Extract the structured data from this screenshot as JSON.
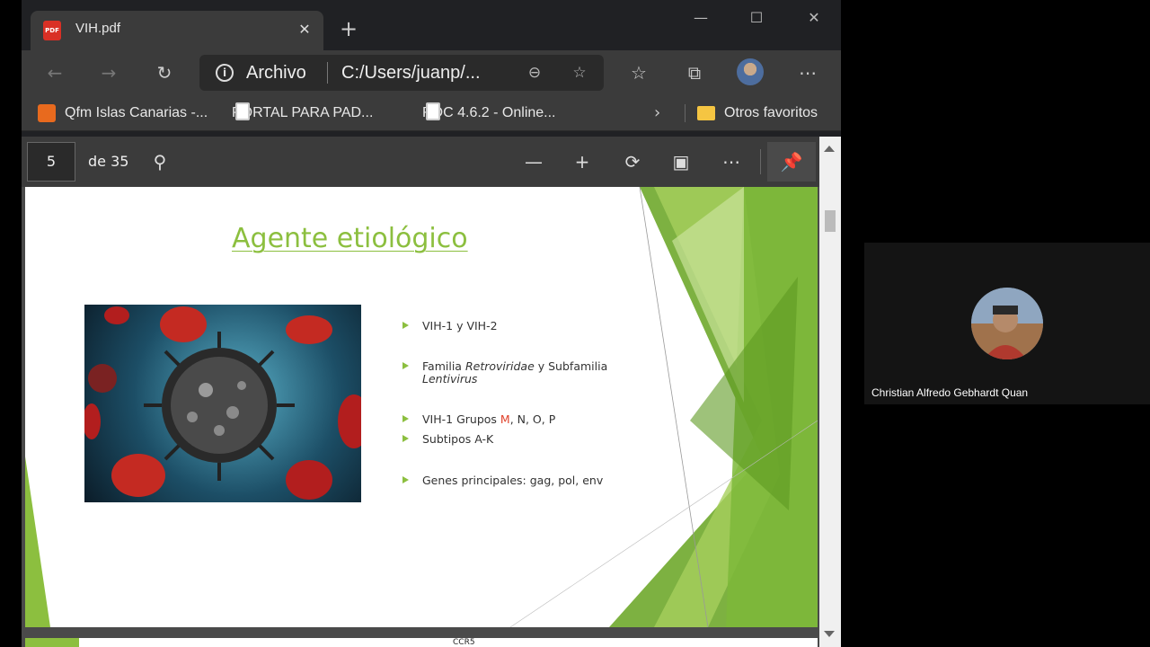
{
  "tab": {
    "title": "VIH.pdf",
    "favicon_label": "PDF"
  },
  "window_controls": {
    "minimize": "—",
    "maximize": "☐",
    "close": "✕"
  },
  "toolbar": {
    "address_scheme": "Archivo",
    "address_url": "C:/Users/juanp/...",
    "icons": [
      "back-icon",
      "forward-icon",
      "refresh-icon",
      "info-icon",
      "zoom-out-icon",
      "add-favorite-icon",
      "favorites-icon",
      "collections-icon",
      "profile-avatar",
      "more-icon"
    ]
  },
  "bookmarks": {
    "items": [
      {
        "label": "Qfm Islas Canarias -..."
      },
      {
        "label": "PORTAL PARA PAD..."
      },
      {
        "label": "RDC 4.6.2 - Online..."
      }
    ],
    "other_favorites": "Otros favoritos"
  },
  "pdf": {
    "current_page": "5",
    "page_total": "de 35"
  },
  "slide": {
    "title": "Agente etiológico",
    "bullets": {
      "b1": "VIH-1 y VIH-2",
      "b2a_pre": "Familia ",
      "b2a_em": "Retroviridae",
      "b2a_post": " y Subfamilia",
      "b2b_em": "Lentivirus",
      "b3_pre": "VIH-1 Grupos ",
      "b3_red": "M",
      "b3_post": ", N, O, P",
      "b4": "Subtipos A-K",
      "b5": "Genes principales: gag, pol, env"
    },
    "next_page_label": "CCR5"
  },
  "participant": {
    "name": "Christian Alfredo Gebhardt Quan"
  },
  "colors": {
    "accent_green": "#8cbf3f",
    "chrome_dark": "#202124",
    "chrome_mid": "#3b3b3b"
  }
}
